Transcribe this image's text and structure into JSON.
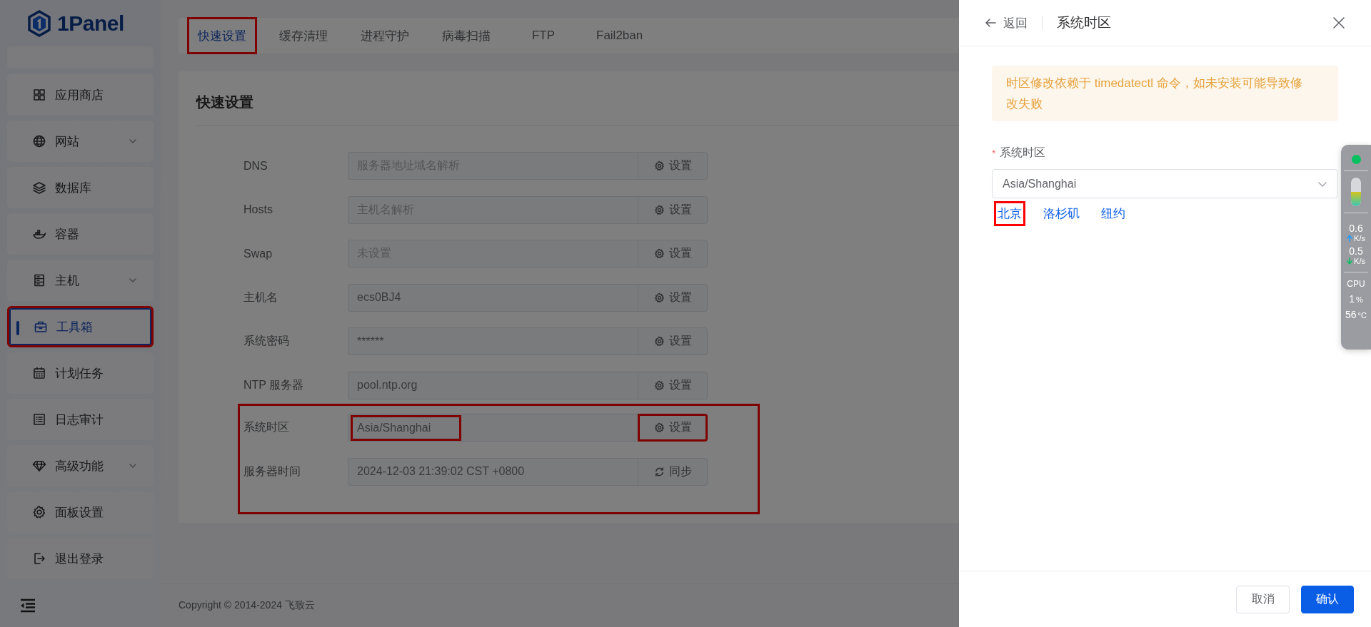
{
  "logo": {
    "text": "1Panel"
  },
  "sidebar": {
    "items": [
      {
        "selected": false,
        "expandable": false,
        "highlighted": false,
        "partial": true
      },
      {
        "label": "应用商店",
        "selected": false,
        "expandable": false,
        "highlighted": false
      },
      {
        "label": "网站",
        "selected": false,
        "expandable": true,
        "highlighted": false
      },
      {
        "label": "数据库",
        "selected": false,
        "expandable": false,
        "highlighted": false
      },
      {
        "label": "容器",
        "selected": false,
        "expandable": false,
        "highlighted": false
      },
      {
        "label": "主机",
        "selected": false,
        "expandable": true,
        "highlighted": false
      },
      {
        "label": "工具箱",
        "selected": true,
        "expandable": false,
        "highlighted": true
      },
      {
        "label": "计划任务",
        "selected": false,
        "expandable": false,
        "highlighted": false
      },
      {
        "label": "日志审计",
        "selected": false,
        "expandable": false,
        "highlighted": false
      },
      {
        "label": "高级功能",
        "selected": false,
        "expandable": true,
        "highlighted": false
      },
      {
        "label": "面板设置",
        "selected": false,
        "expandable": false,
        "highlighted": false
      },
      {
        "label": "退出登录",
        "selected": false,
        "expandable": false,
        "highlighted": false
      }
    ]
  },
  "tabs": [
    {
      "label": "快速设置",
      "selected": true,
      "highlighted": true
    },
    {
      "label": "缓存清理",
      "selected": false,
      "highlighted": false
    },
    {
      "label": "进程守护",
      "selected": false,
      "highlighted": false
    },
    {
      "label": "病毒扫描",
      "selected": false,
      "highlighted": false
    },
    {
      "label": "FTP",
      "selected": false,
      "highlighted": false
    },
    {
      "label": "Fail2ban",
      "selected": false,
      "highlighted": false
    }
  ],
  "card": {
    "title": "快速设置",
    "rows": [
      {
        "label": "DNS",
        "placeholder": "服务器地址域名解析",
        "button": {
          "label": "设置",
          "kind": "settings"
        },
        "framed": false,
        "value_highlighted": false,
        "button_highlighted": false
      },
      {
        "label": "Hosts",
        "placeholder": "主机名解析",
        "button": {
          "label": "设置",
          "kind": "settings"
        },
        "framed": false,
        "value_highlighted": false,
        "button_highlighted": false
      },
      {
        "label": "Swap",
        "placeholder": "未设置",
        "button": {
          "label": "设置",
          "kind": "settings"
        },
        "framed": false,
        "value_highlighted": false,
        "button_highlighted": false
      },
      {
        "label": "主机名",
        "value": "ecs0BJ4",
        "button": {
          "label": "设置",
          "kind": "settings"
        },
        "framed": false,
        "value_highlighted": false,
        "button_highlighted": false
      },
      {
        "label": "系统密码",
        "value": "******",
        "button": {
          "label": "设置",
          "kind": "settings"
        },
        "framed": false,
        "value_highlighted": false,
        "button_highlighted": false
      },
      {
        "label": "NTP 服务器",
        "value": "pool.ntp.org",
        "button": {
          "label": "设置",
          "kind": "settings"
        },
        "framed": false,
        "value_highlighted": false,
        "button_highlighted": false
      },
      {
        "label": "系统时区",
        "value": "Asia/Shanghai",
        "button": {
          "label": "设置",
          "kind": "settings"
        },
        "framed": true,
        "value_highlighted": true,
        "button_highlighted": true
      },
      {
        "label": "服务器时间",
        "value": "2024-12-03 21:39:02 CST +0800",
        "button": {
          "label": "同步",
          "kind": "sync"
        },
        "framed": true,
        "value_highlighted": false,
        "button_highlighted": false
      }
    ]
  },
  "footer": {
    "copyright": "Copyright © 2014-2024 飞致云"
  },
  "drawer": {
    "back": "返回",
    "title": "系统时区",
    "alert": "时区修改依赖于 timedatectl 命令，如未安装可能导致修改失败",
    "field": {
      "required_mark": "*",
      "label": "系统时区",
      "value": "Asia/Shanghai"
    },
    "shortcuts": [
      {
        "label": "北京",
        "highlighted": true
      },
      {
        "label": "洛杉矶",
        "highlighted": false
      },
      {
        "label": "纽约",
        "highlighted": false
      }
    ],
    "buttons": [
      {
        "label": "取消",
        "kind": "default"
      },
      {
        "label": "确认",
        "kind": "primary"
      }
    ]
  },
  "monitor": {
    "memory": {
      "level": 0.5
    },
    "upload": {
      "value": "0.6",
      "unit": "K/s"
    },
    "download": {
      "value": "0.5",
      "unit": "K/s"
    },
    "cpu_label": "CPU",
    "cpu": {
      "value": "1",
      "unit": "%"
    },
    "temp": {
      "value": "56",
      "unit": "°C"
    }
  }
}
